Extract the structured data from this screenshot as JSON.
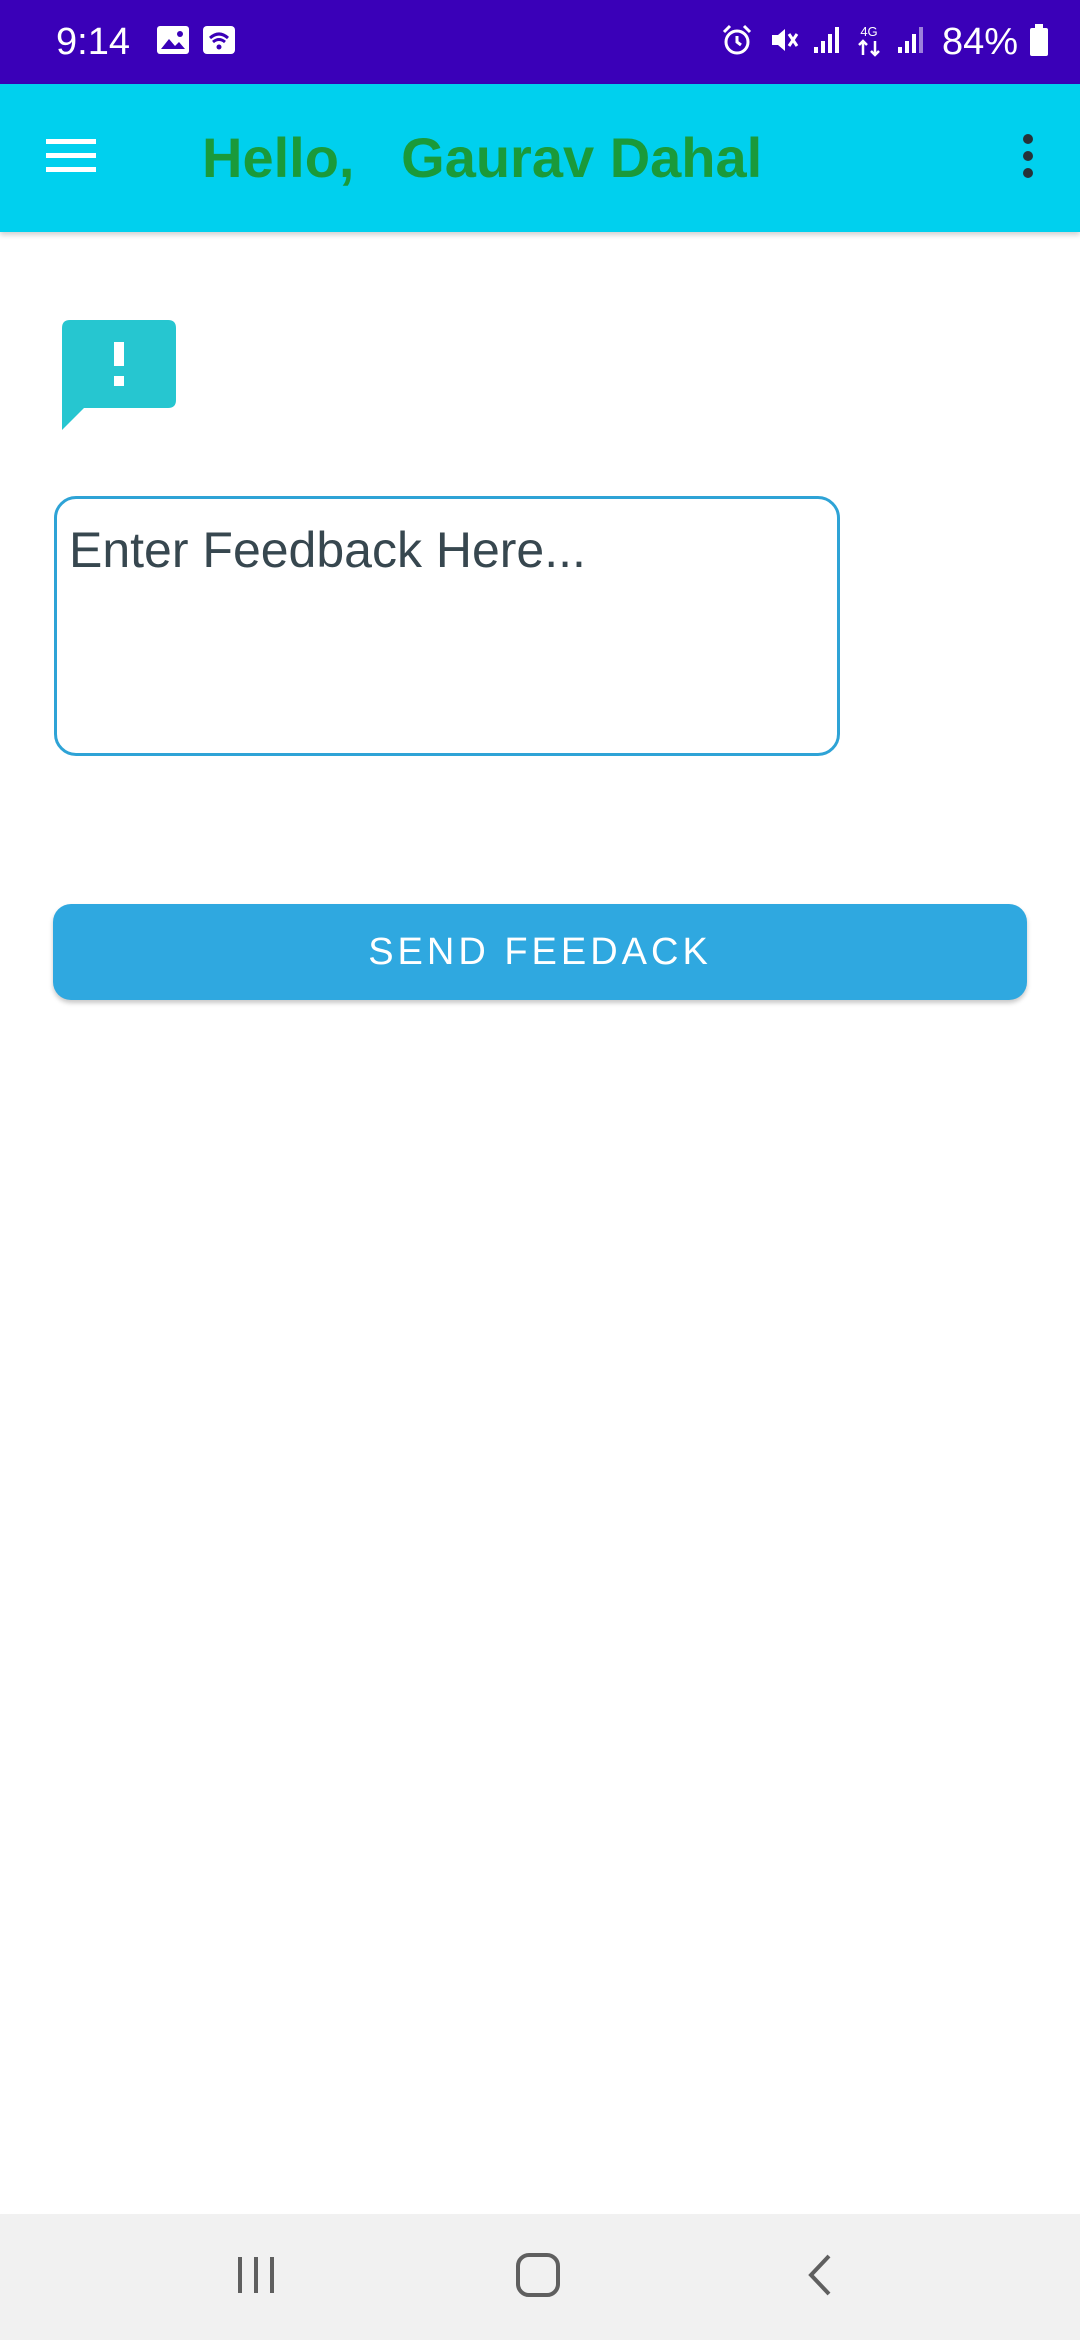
{
  "status_bar": {
    "time": "9:14",
    "battery": "84%",
    "network_label": "4G",
    "left_icons": [
      "image-icon",
      "wifi-hotspot-icon"
    ],
    "right_icons": [
      "alarm-icon",
      "mute-icon",
      "signal-icon",
      "data-4g-icon",
      "signal-icon",
      "battery-icon"
    ],
    "background": "#3a00b8"
  },
  "app_bar": {
    "title": "Hello,   Gaurav Dahal",
    "background": "#00d0ee",
    "title_color": "#1a9a3a",
    "menu_icon": "hamburger-menu-icon",
    "overflow_icon": "more-vert-icon"
  },
  "feedback": {
    "icon": "feedback-icon",
    "icon_color": "#26c6d0",
    "placeholder": "Enter Feedback Here...",
    "value": ""
  },
  "send_button": {
    "label": "SEND FEEDACK",
    "background": "#2fa8e0"
  },
  "nav_bar": {
    "buttons": [
      "recent-apps-icon",
      "home-icon",
      "back-icon"
    ]
  }
}
